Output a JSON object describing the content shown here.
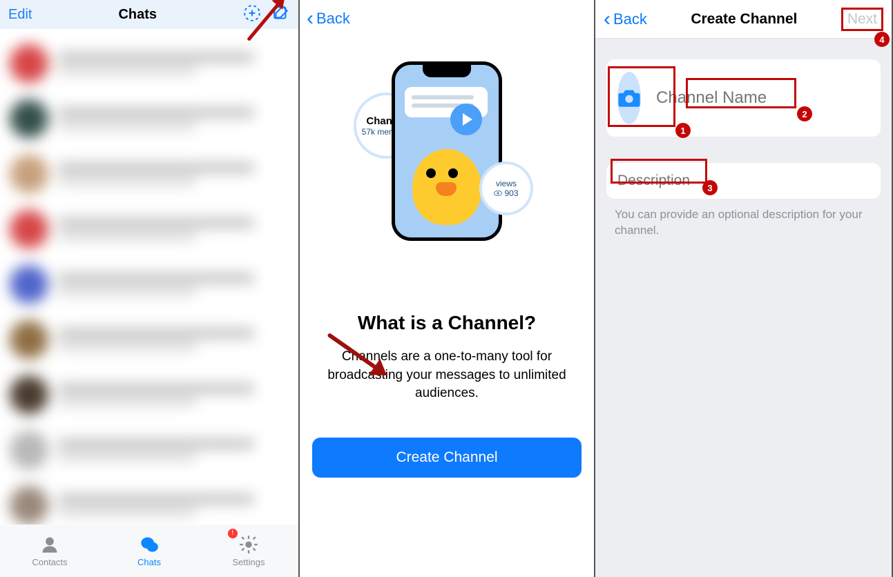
{
  "panel1": {
    "edit": "Edit",
    "title": "Chats",
    "tabs": {
      "contacts": "Contacts",
      "chats": "Chats",
      "settings": "Settings"
    },
    "badge": "!",
    "avatars": [
      "#d74648",
      "#344f4a",
      "#c7a07c",
      "#d74648",
      "#5165cb",
      "#8f6e44",
      "#4a3b2e",
      "#b8b8b8",
      "#9a887a"
    ]
  },
  "panel2": {
    "back": "Back",
    "bubble_channel_title": "Channel",
    "bubble_channel_sub": "57k members",
    "bubble_views_title": "views",
    "bubble_views_value": "903",
    "heading": "What is a Channel?",
    "desc": "Channels are a one-to-many tool for broadcasting your messages to unlimited audiences.",
    "button": "Create Channel"
  },
  "panel3": {
    "back": "Back",
    "title": "Create Channel",
    "next": "Next",
    "name_placeholder": "Channel Name",
    "desc_placeholder": "Description",
    "hint": "You can provide an optional description for your channel.",
    "badges": {
      "b1": "1",
      "b2": "2",
      "b3": "3",
      "b4": "4"
    }
  }
}
